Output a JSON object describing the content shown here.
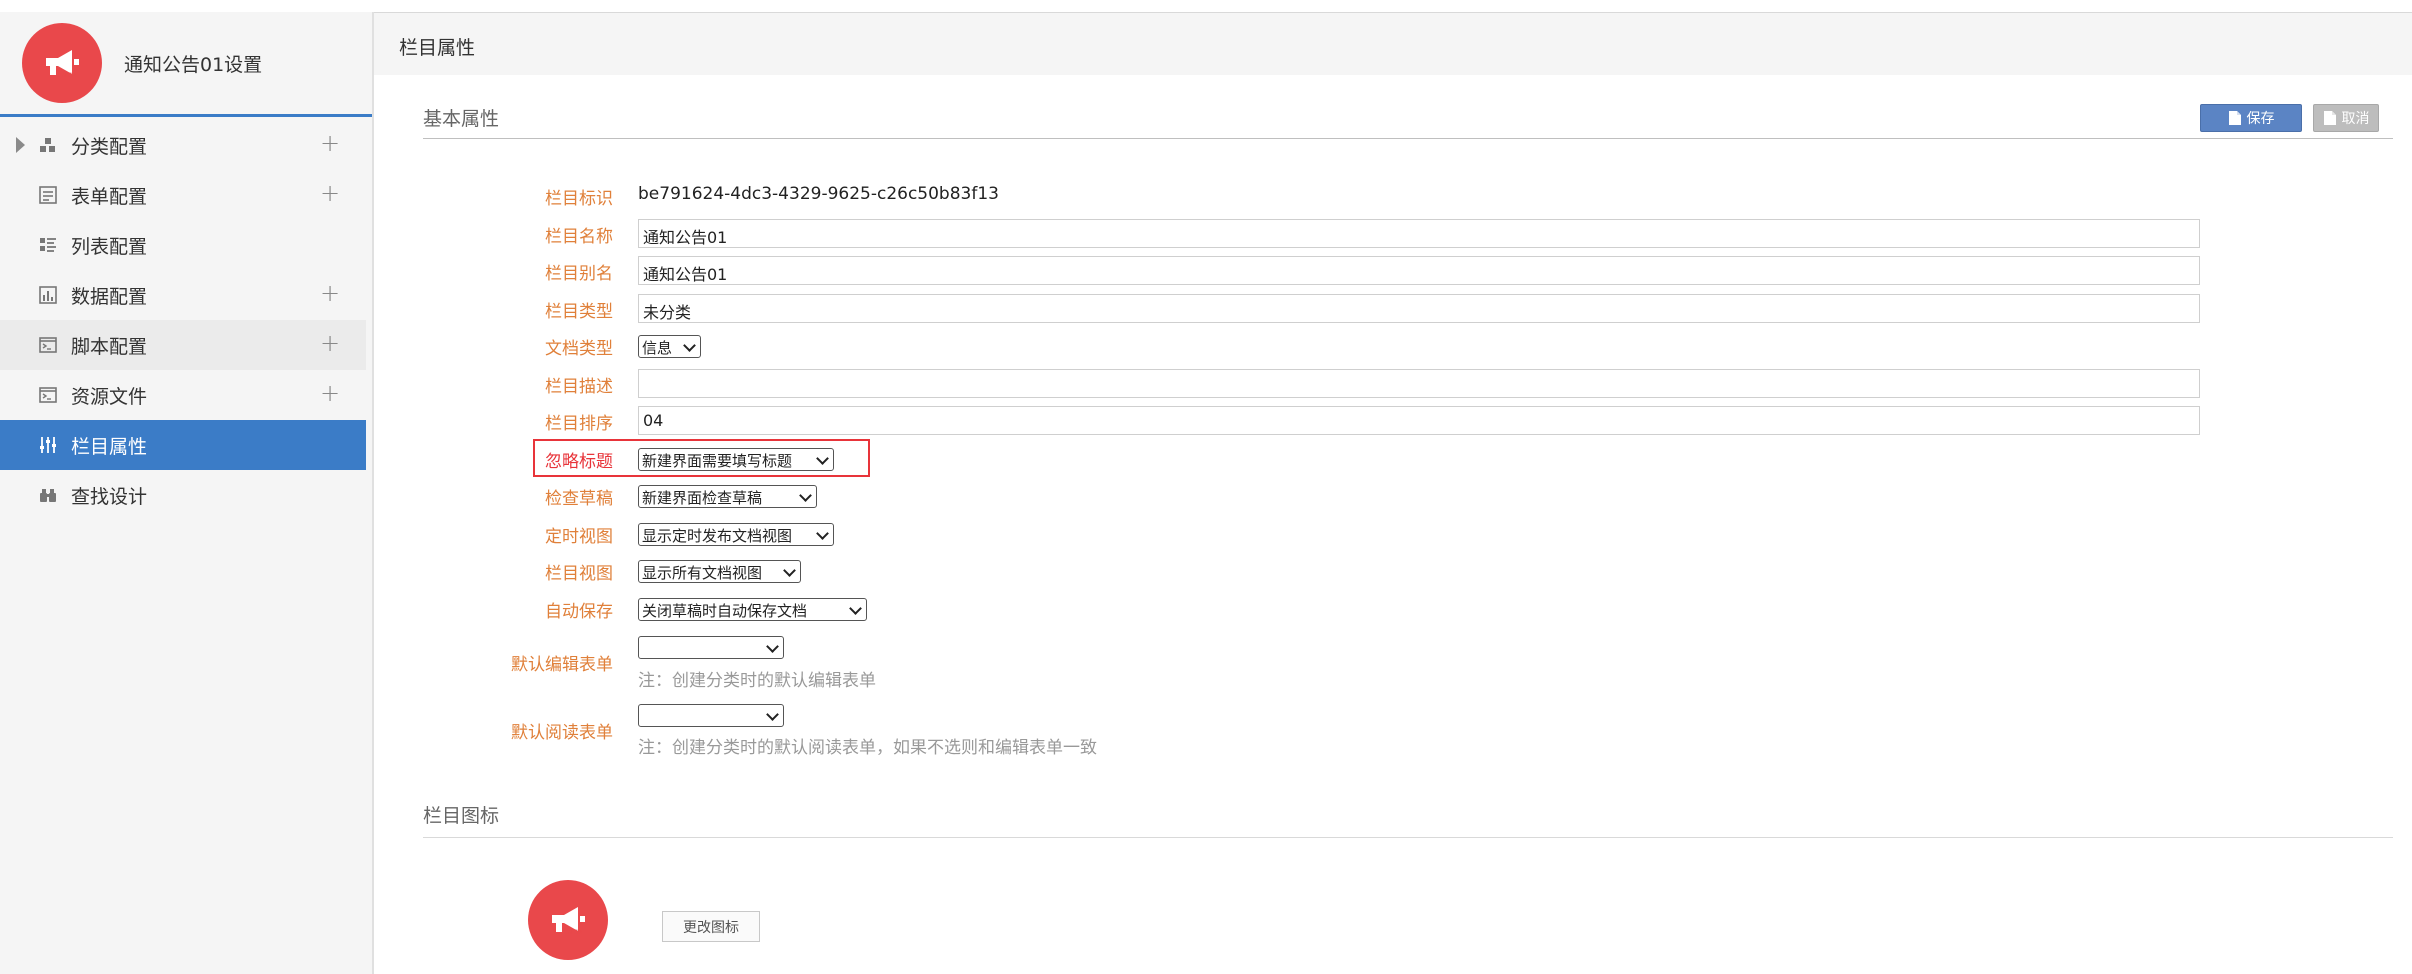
{
  "sidebar": {
    "title": "通知公告01设置",
    "items": [
      {
        "label": "分类配置",
        "icon": "category-icon",
        "has_caret": true,
        "has_add": true
      },
      {
        "label": "表单配置",
        "icon": "form-icon",
        "has_add": true
      },
      {
        "label": "列表配置",
        "icon": "list-icon",
        "has_add": false
      },
      {
        "label": "数据配置",
        "icon": "chart-icon",
        "has_add": true
      },
      {
        "label": "脚本配置",
        "icon": "script-icon",
        "has_add": true
      },
      {
        "label": "资源文件",
        "icon": "resource-icon",
        "has_add": true
      },
      {
        "label": "栏目属性",
        "icon": "sliders-icon",
        "has_add": false,
        "active": true
      },
      {
        "label": "查找设计",
        "icon": "binoculars-icon",
        "has_add": false
      }
    ]
  },
  "header": {
    "title": "栏目属性"
  },
  "basic": {
    "title": "基本属性",
    "save_label": "保存",
    "cancel_label": "取消",
    "id_label": "栏目标识",
    "id_value": "be791624-4dc3-4329-9625-c26c50b83f13",
    "name_label": "栏目名称",
    "name_value": "通知公告01",
    "alias_label": "栏目别名",
    "alias_value": "通知公告01",
    "type_label": "栏目类型",
    "type_value": "未分类",
    "doctype_label": "文档类型",
    "doctype_value": "信息",
    "desc_label": "栏目描述",
    "desc_value": "",
    "order_label": "栏目排序",
    "order_value": "04",
    "ignore_title_label": "忽略标题",
    "ignore_title_value": "新建界面需要填写标题",
    "check_draft_label": "检查草稿",
    "check_draft_value": "新建界面检查草稿",
    "timer_view_label": "定时视图",
    "timer_view_value": "显示定时发布文档视图",
    "column_view_label": "栏目视图",
    "column_view_value": "显示所有文档视图",
    "autosave_label": "自动保存",
    "autosave_value": "关闭草稿时自动保存文档",
    "default_edit_label": "默认编辑表单",
    "default_edit_value": "",
    "default_edit_note": "注：创建分类时的默认编辑表单",
    "default_read_label": "默认阅读表单",
    "default_read_value": "",
    "default_read_note": "注：创建分类时的默认阅读表单，如果不选则和编辑表单一致"
  },
  "icon_section": {
    "title": "栏目图标",
    "change_label": "更改图标"
  },
  "colors": {
    "accent": "#3b7cc7",
    "label": "#e0803a",
    "logo": "#e9484b",
    "highlight_box": "#e8343a"
  }
}
